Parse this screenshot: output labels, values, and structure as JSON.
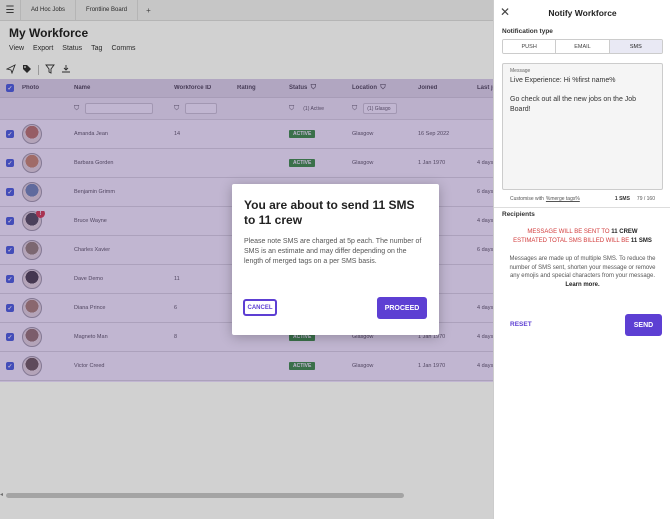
{
  "topbar": {
    "tabs": [
      {
        "label": "Ad Hoc Jobs"
      },
      {
        "label": "Frontline Board"
      }
    ],
    "add_label": "+"
  },
  "page": {
    "title": "My Workforce"
  },
  "menu": [
    {
      "label": "View"
    },
    {
      "label": "Export"
    },
    {
      "label": "Status"
    },
    {
      "label": "Tag"
    },
    {
      "label": "Comms"
    }
  ],
  "table": {
    "headers": {
      "photo": "Photo",
      "name": "Name",
      "workforce_id": "Workforce ID",
      "rating": "Rating",
      "status": "Status",
      "location": "Location",
      "joined": "Joined",
      "last": "Last jo"
    },
    "filters": {
      "status": "(1) Active",
      "location": "(1) Glasgo"
    },
    "rows": [
      {
        "name": "Amanda Jean",
        "id": "14",
        "status": "ACTIVE",
        "location": "Glasgow",
        "joined": "16 Sep 2022",
        "last": ""
      },
      {
        "name": "Barbara Gorden",
        "id": "",
        "status": "ACTIVE",
        "location": "Glasgow",
        "joined": "1 Jan 1970",
        "last": "4 days"
      },
      {
        "name": "Benjamin Grimm",
        "id": "",
        "status": "",
        "location": "",
        "joined": "",
        "last": "6 days"
      },
      {
        "name": "Bruce Wayne",
        "id": "",
        "status": "",
        "location": "",
        "joined": "",
        "last": "4 days"
      },
      {
        "name": "Charles Xavier",
        "id": "",
        "status": "",
        "location": "",
        "joined": "",
        "last": "6 days"
      },
      {
        "name": "Dave Demo",
        "id": "11",
        "status": "",
        "location": "",
        "joined": "",
        "last": ""
      },
      {
        "name": "Diana Prince",
        "id": "6",
        "status": "",
        "location": "",
        "joined": "",
        "last": "4 days"
      },
      {
        "name": "Magneto Man",
        "id": "8",
        "status": "ACTIVE",
        "location": "Glasgow",
        "joined": "1 Jan 1970",
        "last": "4 days"
      },
      {
        "name": "Victor Creed",
        "id": "",
        "status": "ACTIVE",
        "location": "Glasgow",
        "joined": "1 Jan 1970",
        "last": "4 days"
      }
    ],
    "alert_badge": "!"
  },
  "panel": {
    "title": "Notify Workforce",
    "type_label": "Notification type",
    "types": [
      {
        "label": "PUSH"
      },
      {
        "label": "EMAIL"
      },
      {
        "label": "SMS"
      }
    ],
    "message_label": "Message",
    "message_text": "Live Experience: Hi %first name%\n\nGo check out all the new jobs on the Job Board!",
    "customise_prefix": "Customise with",
    "customise_link": "%merge tags%",
    "sms_count": "1 SMS",
    "char_count": "79 / 160",
    "recipients_label": "Recipients",
    "warn_line1_prefix": "MESSAGE WILL BE SENT TO",
    "warn_line1_value": "11 CREW",
    "warn_line2_prefix": "ESTIMATED TOTAL SMS BILLED WILL BE",
    "warn_line2_value": "11 SMS",
    "info_text": "Messages are made up of multiple SMS. To reduce the number of SMS sent, shorten your message or remove any emojis and special characters from your message.",
    "info_link": "Learn more.",
    "reset_label": "RESET",
    "send_label": "SEND"
  },
  "modal": {
    "title": "You are about to send 11 SMS to 11 crew",
    "body": "Please note SMS are charged at 5p each. The number of SMS is an estimate and may differ depending on the length of merged tags on a per SMS basis.",
    "cancel_label": "CANCEL",
    "proceed_label": "PROCEED"
  },
  "colors": {
    "accent": "#5d3fd3",
    "checkbox": "#2b4fd8",
    "active": "#1d8a1d",
    "warning": "#d23b3b"
  }
}
